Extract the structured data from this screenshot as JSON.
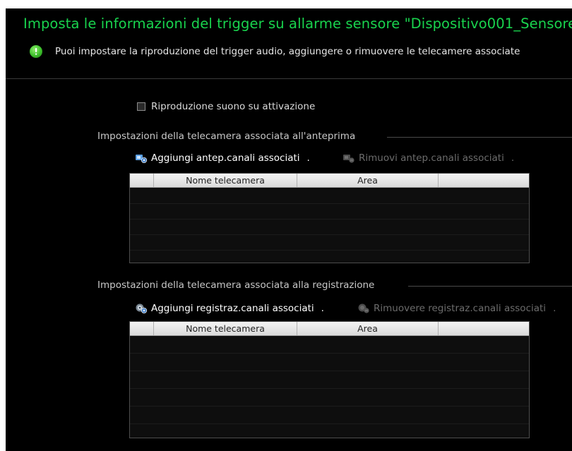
{
  "dialog": {
    "title": "Imposta le informazioni del trigger su allarme sensore \"Dispositivo001_Sensore",
    "subtitle": "Puoi impostare la riproduzione del trigger audio, aggiungere o rimuovere le telecamere associate"
  },
  "audio_trigger": {
    "label": "Riproduzione suono su attivazione",
    "checked": false
  },
  "preview_section": {
    "label": "Impostazioni della telecamera associata all'anteprima",
    "add_label": "Aggiungi antep.canali associati",
    "remove_label": "Rimuovi antep.canali associati",
    "columns": [
      "",
      "Nome telecamera",
      "Area",
      ""
    ],
    "rows": []
  },
  "record_section": {
    "label": "Impostazioni della telecamera associata alla registrazione",
    "add_label": "Aggiungi registraz.canali associati",
    "remove_label": "Rimuovere registraz.canali associati",
    "columns": [
      "",
      "Nome telecamera",
      "Area",
      ""
    ],
    "rows": []
  },
  "colors": {
    "background": "#000000",
    "title_green": "#19d44e",
    "text": "#d9d9d9",
    "disabled_text": "#6c6c6c",
    "table_header": "#e8e8e8"
  },
  "separator": "."
}
